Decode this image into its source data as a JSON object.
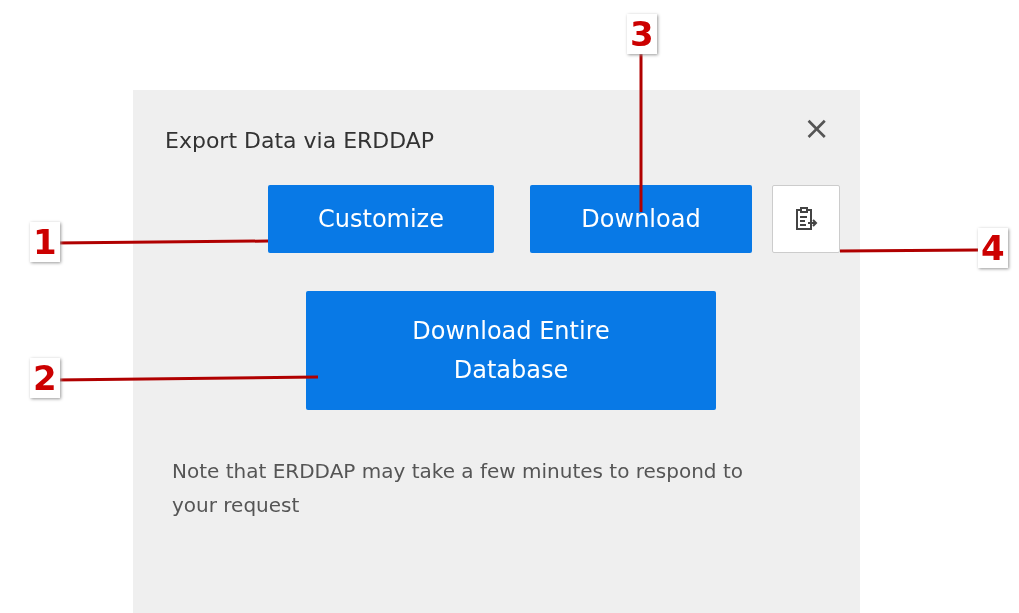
{
  "dialog": {
    "title": "Export Data via ERDDAP",
    "close": "×",
    "buttons": [
      {
        "label": "Customize",
        "kind": "primary"
      },
      {
        "label": "Download",
        "kind": "primary"
      },
      {
        "kind": "icon"
      }
    ],
    "wide_button": {
      "label": "Download Entire Database"
    },
    "note": "Note that ERDDAP may take a few minutes to respond to your request"
  },
  "callouts": [
    {
      "label": "1"
    },
    {
      "label": "2"
    },
    {
      "label": "3"
    },
    {
      "label": "4"
    }
  ]
}
